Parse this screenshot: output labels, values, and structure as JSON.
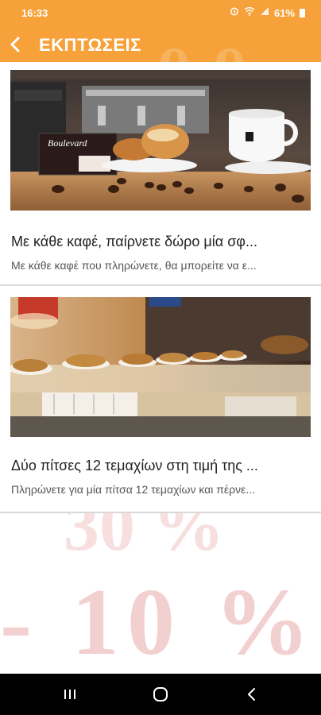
{
  "status_bar": {
    "time": "16:33",
    "battery": "61%",
    "icons": [
      "alarm-icon",
      "wifi-icon",
      "signal-icon",
      "battery-icon"
    ]
  },
  "app_bar": {
    "title": "ΕΚΠΤΩΣΕΙΣ",
    "back_icon": "chevron-left-icon",
    "color": "#f6a13a"
  },
  "offers": [
    {
      "image_label": "coffee-and-pastry-photo",
      "logo_text": "Boulevard",
      "title": "Με κάθε καφέ, παίρνετε δώρο μία σφ...",
      "description": "Με κάθε καφέ που πληρώνετε, θα μπορείτε να ε..."
    },
    {
      "image_label": "pizza-display-photo",
      "title": "Δύο πίτσες 12 τεμαχίων στη τιμή της ...",
      "description": "Πληρώνετε για μία πίτσα 12 τεμαχίων και πέρνε..."
    }
  ],
  "background": {
    "top_text": "30 %",
    "main_text": "- 10 %"
  },
  "nav_bar": {
    "buttons": [
      "recents-icon",
      "home-icon",
      "back-icon"
    ]
  }
}
